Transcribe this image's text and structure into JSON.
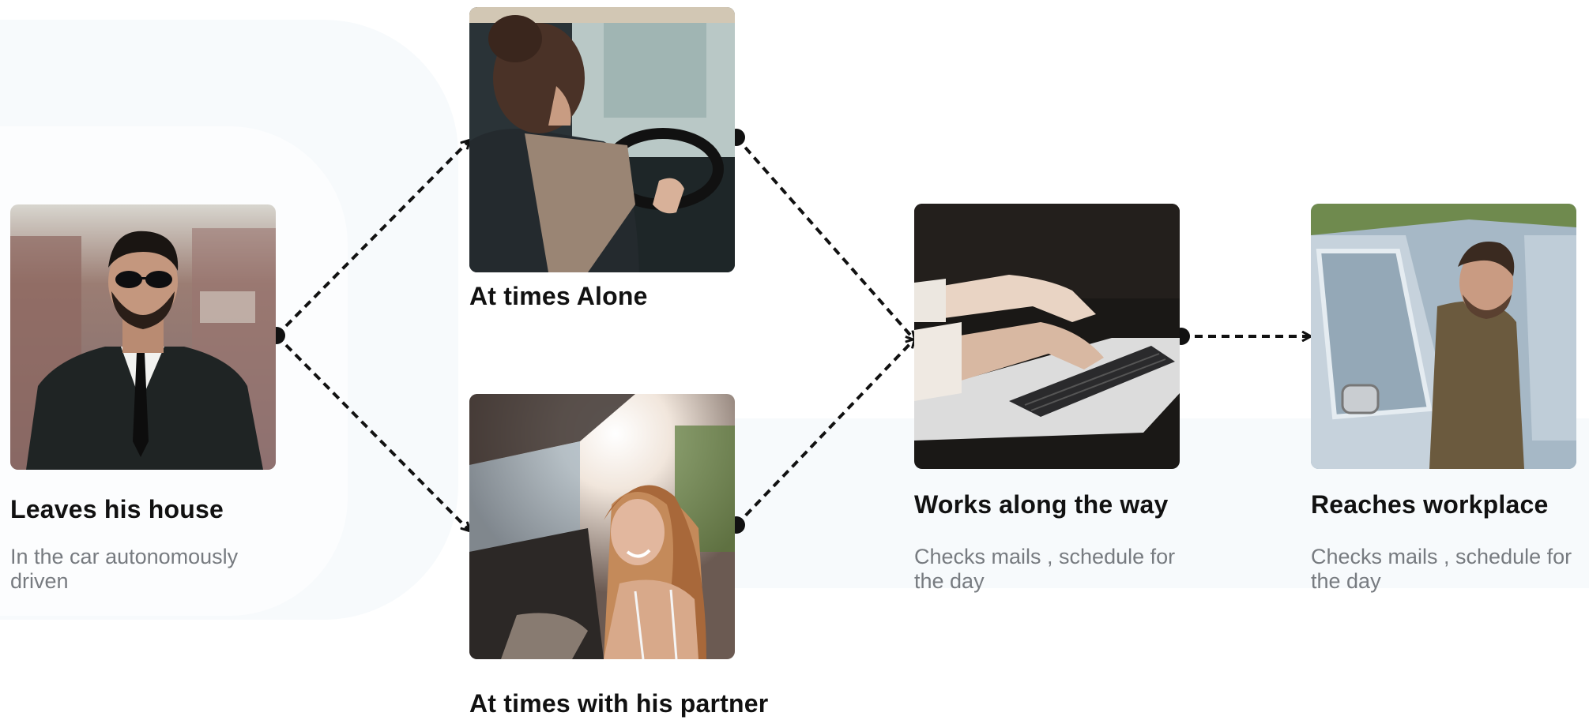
{
  "steps": {
    "leaves": {
      "title": "Leaves his house",
      "description": "In the car autonomously driven"
    },
    "alone": {
      "title": "At times Alone"
    },
    "partner": {
      "title": "At times with his partner"
    },
    "works": {
      "title": "Works along the way",
      "description": "Checks mails , schedule for the day"
    },
    "reaches": {
      "title": "Reaches workplace",
      "description": "Checks mails , schedule for the day"
    }
  },
  "colors": {
    "connector": "#111111",
    "title_text": "#111111",
    "description_text": "#777b80",
    "background_accent": "#f7fafc"
  }
}
